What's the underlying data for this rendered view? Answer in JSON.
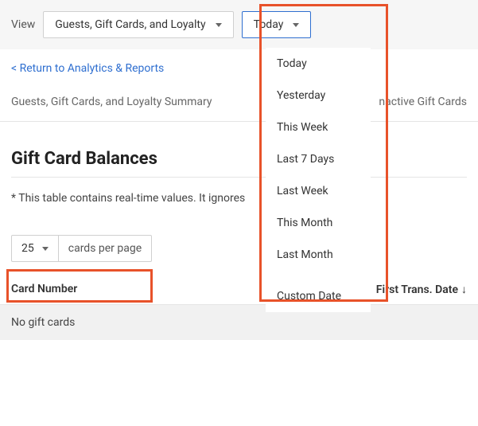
{
  "topbar": {
    "view_label": "View",
    "view_value": "Guests, Gift Cards, and Loyalty",
    "date_value": "Today"
  },
  "return_link": "< Return to Analytics & Reports",
  "tabs": {
    "summary": "Guests, Gift Cards, and Loyalty Summary",
    "inactive": "nactive Gift Cards"
  },
  "heading": "Gift Card Balances",
  "note": "* This table contains real-time values. It ignores",
  "pager": {
    "count": "25",
    "label": "cards per page"
  },
  "table": {
    "col_card": "Card Number",
    "col_first": "First Trans. Date",
    "empty": "No gift cards"
  },
  "date_menu": {
    "today": "Today",
    "yesterday": "Yesterday",
    "this_week": "This Week",
    "last7": "Last 7 Days",
    "last_week": "Last Week",
    "this_month": "This Month",
    "last_month": "Last Month",
    "custom": "Custom Date"
  }
}
